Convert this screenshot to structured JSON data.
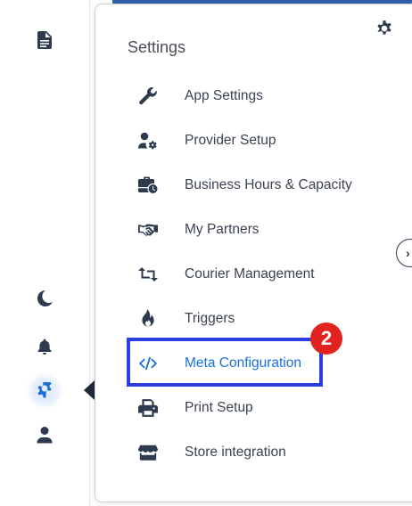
{
  "panel": {
    "title": "Settings",
    "items": [
      {
        "label": "App Settings",
        "icon": "wrench-icon"
      },
      {
        "label": "Provider Setup",
        "icon": "user-gear-icon"
      },
      {
        "label": "Business Hours & Capacity",
        "icon": "business-time-icon"
      },
      {
        "label": "My Partners",
        "icon": "handshake-icon"
      },
      {
        "label": "Courier Management",
        "icon": "retweet-icon"
      },
      {
        "label": "Triggers",
        "icon": "fire-icon"
      },
      {
        "label": "Meta Configuration",
        "icon": "code-icon"
      },
      {
        "label": "Print Setup",
        "icon": "print-icon"
      },
      {
        "label": "Store integration",
        "icon": "store-icon"
      }
    ]
  },
  "annotation": {
    "step": "2",
    "color": "#e0231f",
    "box_color": "#2b3fe0"
  },
  "sidebar": {
    "icons": [
      "document-icon",
      "moon-icon",
      "bell-icon",
      "gear-icon",
      "user-icon"
    ],
    "active": "gear-icon",
    "accent": "#1a6fd6"
  },
  "collapse": {
    "glyph": "›"
  }
}
